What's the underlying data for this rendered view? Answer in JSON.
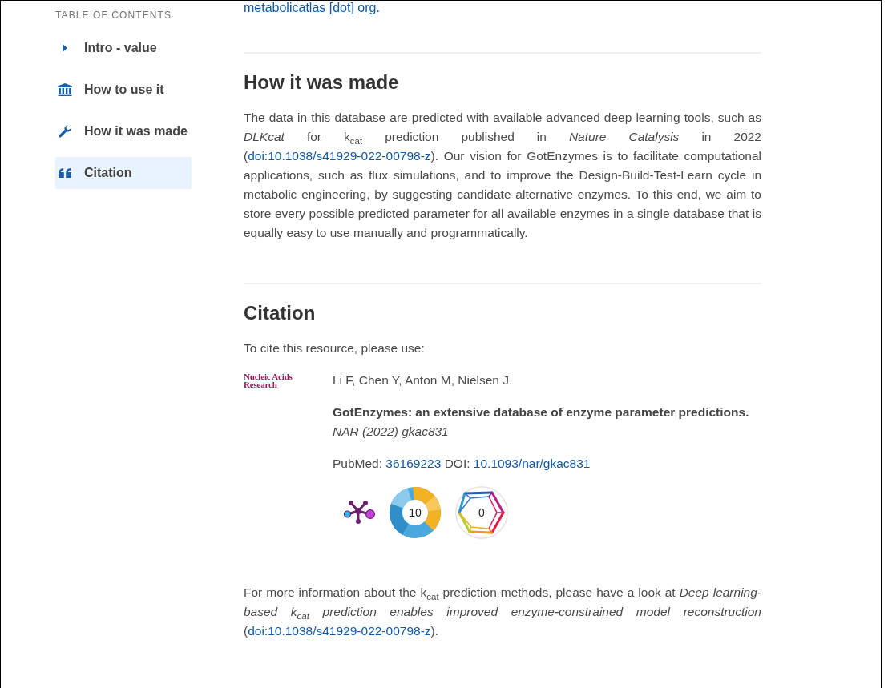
{
  "sidebar": {
    "heading": "TABLE OF CONTENTS",
    "items": [
      {
        "label": "Intro - value",
        "selected": false
      },
      {
        "label": "How to use it",
        "selected": false
      },
      {
        "label": "How it was made",
        "selected": false
      },
      {
        "label": "Citation",
        "selected": true
      }
    ]
  },
  "top_link": "metabolicatlas [dot] org.",
  "made_section": {
    "heading": "How it was made",
    "paragraph": [
      {
        "text": "The data in this database are predicted with available advanced deep learning tools, such as *DLKcat* for k$_{cat}$ prediction published in *Nature Catalysis* in 2022 ("
      },
      {
        "link": "doi:10.1038/s41929-022-00798-z"
      },
      {
        "text": "). Our vision for GotEnzymes is to facilitate computational applications, such as flux simulations, and to improve the Design-Build-Test-Learn cycle in metabolic engineering, by suggesting candidate alternative enzymes. To this end, we aim to store every possible predicted parameter for all available enzymes in a single database that is equally easy to use manually and programmatically."
      }
    ]
  },
  "citation_section": {
    "heading": "Citation",
    "intro": "To cite this resource, please use:",
    "journal_logo": "Nucleic Acids Research",
    "authors": "Li F, Chen Y, Anton M, Nielsen J.",
    "title": "GotEnzymes: an extensive database of enzyme parameter predictions.",
    "journal": "NAR (2022) gkac831",
    "pubmed_label": "PubMed:",
    "pubmed_id": "36169223",
    "doi_label": "DOI:",
    "doi": "10.1093/nar/gkac831",
    "badges": [
      {
        "kind": "node"
      },
      {
        "kind": "ring",
        "count": "10"
      },
      {
        "kind": "polygon",
        "count": "0"
      }
    ]
  },
  "more_info": [
    {
      "text": "For more information about the k$_{cat}$ prediction methods, please have a look at *Deep learning-based k$_{cat}$ prediction enables improved enzyme-constrained model reconstruction* ("
    },
    {
      "link": "doi:10.1038/s41929-022-00798-z"
    },
    {
      "text": ")."
    }
  ]
}
